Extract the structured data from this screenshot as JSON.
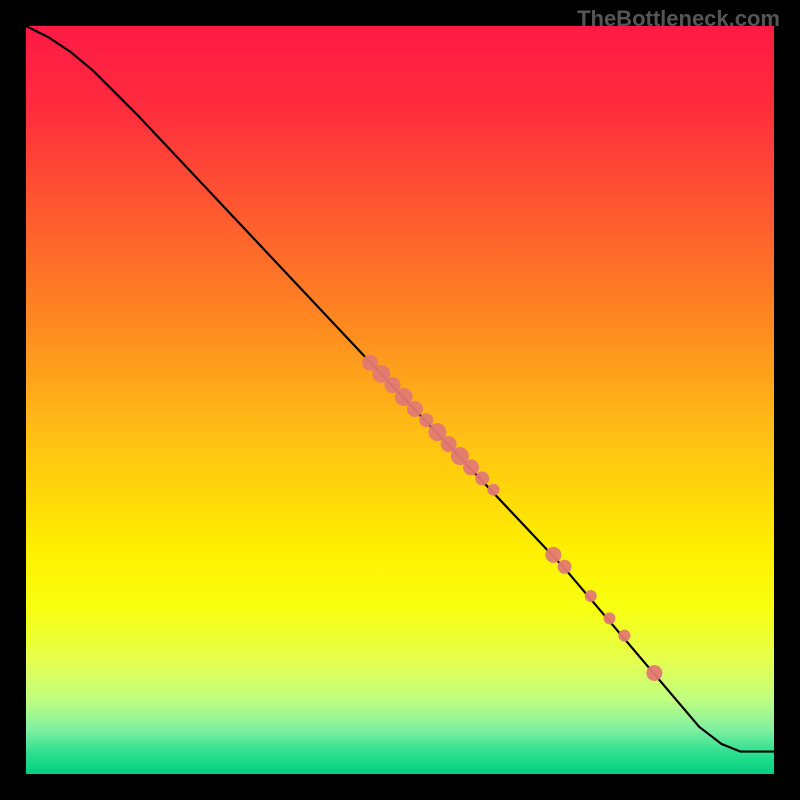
{
  "watermark": "TheBottleneck.com",
  "chart_data": {
    "type": "line",
    "title": "",
    "xlabel": "",
    "ylabel": "",
    "xlim": [
      0,
      100
    ],
    "ylim": [
      0,
      100
    ],
    "background_gradient": {
      "stops": [
        {
          "offset": 0.0,
          "color": "#ff1a44"
        },
        {
          "offset": 0.1,
          "color": "#ff2a3e"
        },
        {
          "offset": 0.25,
          "color": "#ff5a30"
        },
        {
          "offset": 0.4,
          "color": "#ff8a20"
        },
        {
          "offset": 0.55,
          "color": "#ffc014"
        },
        {
          "offset": 0.7,
          "color": "#fff000"
        },
        {
          "offset": 0.78,
          "color": "#f8ff10"
        },
        {
          "offset": 0.85,
          "color": "#e4ff50"
        },
        {
          "offset": 0.9,
          "color": "#c0ff80"
        },
        {
          "offset": 0.94,
          "color": "#80f0a0"
        },
        {
          "offset": 0.97,
          "color": "#30e090"
        },
        {
          "offset": 1.0,
          "color": "#00d080"
        }
      ]
    },
    "series": [
      {
        "name": "curve",
        "type": "line",
        "color": "#000000",
        "points": [
          {
            "x": 0.0,
            "y": 100.0
          },
          {
            "x": 3.0,
            "y": 98.5
          },
          {
            "x": 6.0,
            "y": 96.5
          },
          {
            "x": 9.0,
            "y": 94.0
          },
          {
            "x": 12.0,
            "y": 91.0
          },
          {
            "x": 15.0,
            "y": 88.0
          },
          {
            "x": 47.0,
            "y": 54.0
          },
          {
            "x": 72.0,
            "y": 27.5
          },
          {
            "x": 90.0,
            "y": 6.3
          },
          {
            "x": 93.0,
            "y": 4.0
          },
          {
            "x": 95.5,
            "y": 3.0
          },
          {
            "x": 100.0,
            "y": 3.0
          }
        ]
      },
      {
        "name": "markers",
        "type": "scatter",
        "color": "#e27a72",
        "points": [
          {
            "x": 46.0,
            "y": 55.0,
            "r": 8
          },
          {
            "x": 47.5,
            "y": 53.5,
            "r": 9
          },
          {
            "x": 49.0,
            "y": 52.0,
            "r": 8
          },
          {
            "x": 50.5,
            "y": 50.4,
            "r": 9
          },
          {
            "x": 52.0,
            "y": 48.8,
            "r": 8
          },
          {
            "x": 53.5,
            "y": 47.3,
            "r": 7
          },
          {
            "x": 55.0,
            "y": 45.7,
            "r": 9
          },
          {
            "x": 56.5,
            "y": 44.1,
            "r": 8
          },
          {
            "x": 58.0,
            "y": 42.5,
            "r": 9
          },
          {
            "x": 59.5,
            "y": 41.0,
            "r": 8
          },
          {
            "x": 61.0,
            "y": 39.5,
            "r": 7
          },
          {
            "x": 62.5,
            "y": 38.0,
            "r": 6
          },
          {
            "x": 70.5,
            "y": 29.3,
            "r": 8
          },
          {
            "x": 72.0,
            "y": 27.7,
            "r": 7
          },
          {
            "x": 75.5,
            "y": 23.8,
            "r": 6
          },
          {
            "x": 78.0,
            "y": 20.8,
            "r": 6
          },
          {
            "x": 80.0,
            "y": 18.5,
            "r": 6
          },
          {
            "x": 84.0,
            "y": 13.5,
            "r": 8
          }
        ]
      }
    ]
  }
}
